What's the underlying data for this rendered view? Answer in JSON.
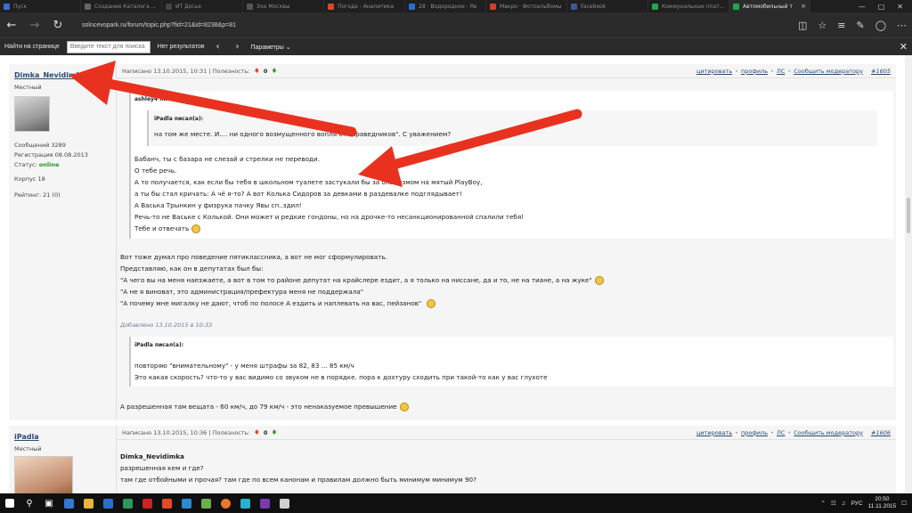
{
  "tabs": [
    {
      "title": "Пуск",
      "color": "#3a6fd0",
      "active": false
    },
    {
      "title": "Создание Каталога стр",
      "color": "#666",
      "active": false
    },
    {
      "title": "ИТ Досье",
      "color": "#444",
      "active": false
    },
    {
      "title": "Эхо Москвы",
      "color": "#555",
      "active": false
    },
    {
      "title": "Погода - Аналитика",
      "color": "#d04a2a",
      "active": false
    },
    {
      "title": "28 · Водородное - Re",
      "color": "#2a6fd0",
      "active": false
    },
    {
      "title": "Макро · Фотоальбомы",
      "color": "#d0402a",
      "active": false
    },
    {
      "title": "Facebook",
      "color": "#3b5998",
      "active": false
    },
    {
      "title": "Коммунальные платеж",
      "color": "#22a84a",
      "active": false
    },
    {
      "title": "Автомобильный т",
      "color": "#22a84a",
      "active": true
    }
  ],
  "url": "solncevopark.ru/forum/topic.php?fid=21&id=8238&p=81",
  "findbar": {
    "label": "Найти на странице",
    "placeholder": "Введите текст для поиска",
    "result": "Нет результатов",
    "params": "Параметры"
  },
  "post1": {
    "author": "Dimka_Nevidimka",
    "rank": "Местный",
    "messages": "Сообщений  3289",
    "registration": "Регистрация  08.08.2013",
    "status_label": "Статус:",
    "status_value": "online",
    "korpus": "Корпус  18",
    "rating": "Рейтинг:  21 (0)",
    "written": "Написано  13.10.2015, 10:31  |  Полезность:",
    "vote_value": "0",
    "actions": [
      "цитировать",
      "профиль",
      "ЛС",
      "Сообщить модератору"
    ],
    "number": "#1605",
    "quote_outer_author": "ashley4 писал(а):",
    "quote_inner_author": "iPadla писал(а):",
    "quote_inner_text": "на том же месте. И.... ни одного возмущенного вопля от \"праведников\". С уважением?",
    "quote_lines": [
      "Бабанч, ты с базара не слезай и стрелки не переводи.",
      "О тебе речь.",
      "А то получается, как если бы тебя в школьном туалете застукали бы за онанизмом на мятый PlayBoy,",
      "а ты бы стал кричать: А чё я-то? А вот Колька Сидоров за девками в раздевалке подглядывает!",
      "А Васька Трынкин у физрука пачку Явы сп..здил!",
      "Речь-то не Ваське с Колькой. Они может и редкие гондоны, но на дрочке-то несанкционированной спалили тебя!",
      "Тебе и отвечать"
    ],
    "body_lines": [
      "Вот тоже думал про поведение пятиклассника, а вот не мог сформулировать.",
      "Представляю, как он в депутатах был бы:",
      "\"А чего вы на меня наезжаете, а вот в том то районе депутат на крайслере ездит, а я только на ниссане, да и то, не на тиане, а на жуке\"",
      "\"А не я виноват, это администрация/префектура меня не поддержала\"",
      "\"А почему мне мигалку не дают, чтоб по полосе А ездить и наплевать на вас, пейзанов\""
    ],
    "added": "Добавлено 13.10.2015 в 10:33",
    "quote2_author": "iPadla писал(а):",
    "quote2_lines": [
      "повторяю \"внимательному\" - у меня штрафы за 82, 83 ... 85 км/ч",
      "Это какая скорость? что-то у вас видимо со звуком не в порядке. пора к дохтуру сходить при такой-то как у вас глухоте"
    ],
    "final_line": "А разрешенная там вещата - 60 км/ч, до 79 км/ч - это ненаказуемое превышение"
  },
  "post2": {
    "author": "iPadla",
    "rank": "Местный",
    "written": "Написано  13.10.2015, 10:36  |  Полезность:",
    "vote_value": "0",
    "actions": [
      "цитировать",
      "профиль",
      "ЛС",
      "Сообщить модератору"
    ],
    "number": "#1606",
    "quote_author": "Dimka_Nevidimka",
    "lines": [
      "разрешенная кем и где?",
      "там где отбойными и прочая? там где по всем канонам и правилам должно быть минимум минимум 90?"
    ]
  },
  "taskbar": {
    "lang": "РУС",
    "time": "20:50",
    "date": "11.11.2015"
  },
  "colors": {
    "arrow": "#e8321f",
    "link": "#2a4a73",
    "online": "#1f9a1f"
  }
}
